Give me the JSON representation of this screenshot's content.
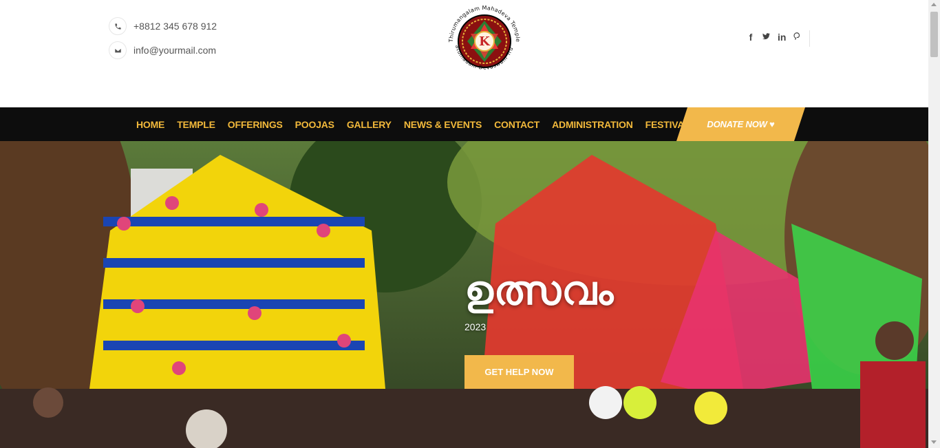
{
  "header": {
    "phone": "+8812 345 678 912",
    "email": "info@yourmail.com",
    "phone_icon": "phone-icon",
    "email_icon": "envelope-icon"
  },
  "logo": {
    "letter": "K",
    "ring_text_top": "Thirumangalam Mahadeva Temple",
    "ring_text_bottom": "Katumadam Devaswam Trust"
  },
  "social": {
    "icons": [
      "facebook-icon",
      "twitter-icon",
      "linkedin-icon",
      "pinterest-icon"
    ],
    "glyphs": [
      "f",
      "t",
      "in",
      "p"
    ]
  },
  "nav": {
    "items": [
      "HOME",
      "TEMPLE",
      "OFFERINGS",
      "POOJAS",
      "GALLERY",
      "NEWS & EVENTS",
      "CONTACT",
      "ADMINISTRATION",
      "FESTIVALS"
    ],
    "donate_label": "DONATE NOW ♥"
  },
  "hero": {
    "title": "ഉത്സവം",
    "year": "2023",
    "button_label": "GET HELP NOW"
  },
  "colors": {
    "accent": "#f2b93b",
    "nav_bg": "#0d0d0d",
    "button_bg": "#f2b84b"
  }
}
